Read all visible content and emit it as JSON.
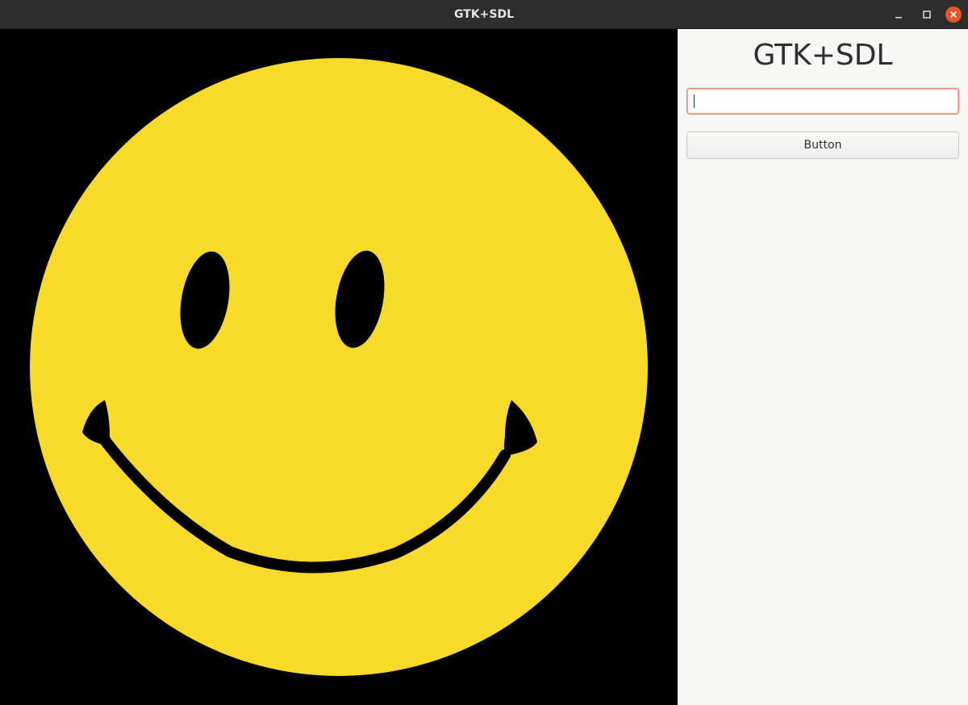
{
  "window": {
    "title": "GTK+SDL",
    "controls": {
      "minimize": "minimize-icon",
      "maximize": "maximize-icon",
      "close": "close-icon"
    },
    "accent_color": "#e95420"
  },
  "canvas": {
    "background_color": "#000000",
    "face_color": "#f8da2b",
    "feature_color": "#000000",
    "content": "smiley-face"
  },
  "side_panel": {
    "heading": "GTK+SDL",
    "entry": {
      "value": "",
      "placeholder": ""
    },
    "button_label": "Button"
  }
}
